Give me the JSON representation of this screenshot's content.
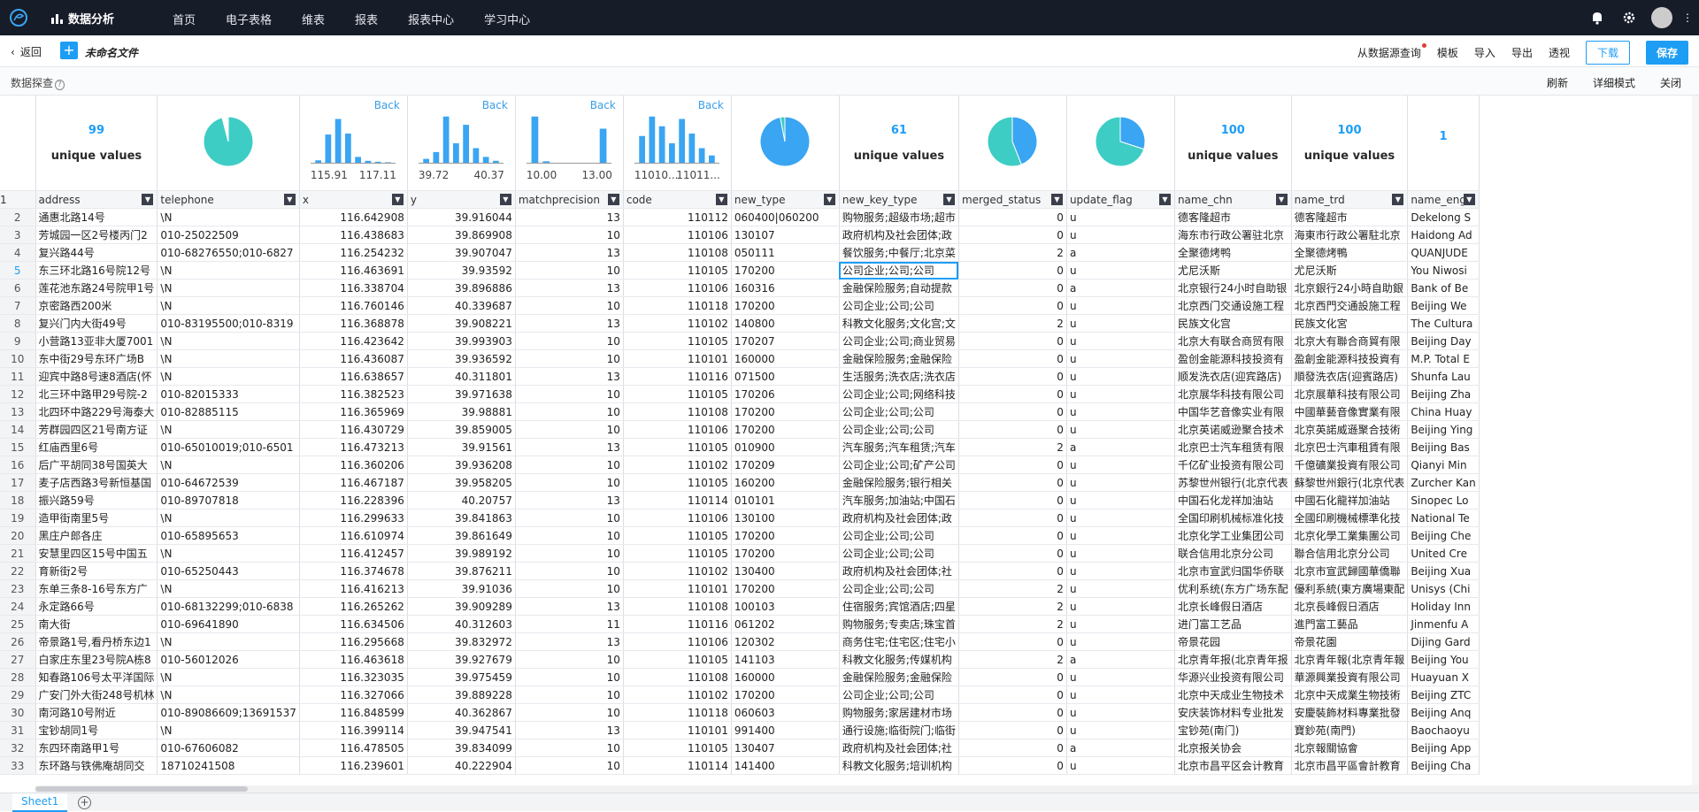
{
  "topnav": {
    "brand": "数据分析",
    "menu": [
      "首页",
      "电子表格",
      "维表",
      "报表",
      "报表中心",
      "学习中心"
    ]
  },
  "filebar": {
    "back": "返回",
    "filename": "未命名文件",
    "actions": [
      "从数据源查询",
      "模板",
      "导入",
      "导出",
      "透视"
    ],
    "download": "下载",
    "save": "保存"
  },
  "probebar": {
    "title": "数据探查",
    "actions": [
      "刷新",
      "详细模式",
      "关闭"
    ]
  },
  "summary": {
    "address": {
      "type": "unique",
      "count": "99",
      "label": "unique values"
    },
    "telephone": {
      "type": "pie",
      "fractions": [
        0.96,
        0.04
      ],
      "colors": [
        "#3ecdc4",
        "#ffffff"
      ]
    },
    "x": {
      "type": "hist",
      "back": "Back",
      "min": "115.91",
      "max": "117.11",
      "bars": [
        0.05,
        0.58,
        0.9,
        0.6,
        0.12,
        0.04,
        0.02,
        0.01
      ]
    },
    "y": {
      "type": "hist",
      "back": "Back",
      "min": "39.72",
      "max": "40.37",
      "bars": [
        0.08,
        0.22,
        0.95,
        0.4,
        0.78,
        0.3,
        0.12,
        0.04
      ]
    },
    "matchprecision": {
      "type": "hist",
      "back": "Back",
      "min": "10.00",
      "max": "13.00",
      "bars": [
        0.95,
        0.03,
        0.0,
        0.0,
        0.0,
        0.0,
        0.7
      ]
    },
    "code": {
      "type": "hist",
      "back": "Back",
      "min": "11010...",
      "max": "11011...",
      "bars": [
        0.55,
        0.95,
        0.75,
        0.4,
        0.9,
        0.6,
        0.3,
        0.15
      ]
    },
    "new_type": {
      "type": "pie",
      "fractions": [
        0.97,
        0.03
      ],
      "colors": [
        "#3aa5f2",
        "#3ecdc4"
      ]
    },
    "new_key_type": {
      "type": "unique",
      "count": "61",
      "label": "unique values"
    },
    "merged_status": {
      "type": "pie",
      "fractions": [
        0.44,
        0.56
      ],
      "colors": [
        "#3aa5f2",
        "#3ecdc4"
      ]
    },
    "update_flag": {
      "type": "pie",
      "fractions": [
        0.3,
        0.7
      ],
      "colors": [
        "#3aa5f2",
        "#3ecdc4"
      ]
    },
    "name_chn": {
      "type": "unique",
      "count": "100",
      "label": "unique values"
    },
    "name_trd": {
      "type": "unique",
      "count": "100",
      "label": "unique values"
    },
    "name_eng": {
      "type": "unique",
      "count": "1",
      "label": ""
    }
  },
  "columns": [
    "address",
    "telephone",
    "x",
    "y",
    "matchprecision",
    "code",
    "new_type",
    "new_key_type",
    "merged_status",
    "update_flag",
    "name_chn",
    "name_trd",
    "name_eng"
  ],
  "rows": [
    [
      "通惠北路14号",
      "\\N",
      "116.642908",
      "39.916044",
      "13",
      "110112",
      "060400|060200",
      "购物服务;超级市场;超市",
      "0",
      "u",
      "德客隆超市",
      "德客隆超市",
      "Dekelong S"
    ],
    [
      "芳城园一区2号楼丙门2",
      "010-25022509",
      "116.438683",
      "39.869908",
      "10",
      "110106",
      "130107",
      "政府机构及社会团体;政",
      "0",
      "u",
      "海东市行政公署驻北京",
      "海東市行政公署駐北京",
      "Haidong Ad"
    ],
    [
      "复兴路44号",
      "010-68276550;010-6827",
      "116.254232",
      "39.907047",
      "13",
      "110108",
      "050111",
      "餐饮服务;中餐厅;北京菜",
      "2",
      "a",
      "全聚德烤鸭",
      "全聚德烤鴨",
      "QUANJUDE"
    ],
    [
      "东三环北路16号院12号",
      "\\N",
      "116.463691",
      "39.93592",
      "10",
      "110105",
      "170200",
      "公司企业;公司;公司",
      "0",
      "u",
      "尤尼沃斯",
      "尤尼沃斯",
      "You Niwosi"
    ],
    [
      "莲花池东路24号院甲1号",
      "\\N",
      "116.338704",
      "39.896886",
      "13",
      "110106",
      "160316",
      "金融保险服务;自动提款",
      "0",
      "a",
      "北京银行24小时自助银",
      "北京銀行24小時自助銀",
      "Bank of Be"
    ],
    [
      "京密路西200米",
      "\\N",
      "116.760146",
      "40.339687",
      "10",
      "110118",
      "170200",
      "公司企业;公司;公司",
      "0",
      "u",
      "北京西门交通设施工程",
      "北京西門交通設施工程",
      "Beijing We"
    ],
    [
      "复兴门内大街49号",
      "010-83195500;010-8319",
      "116.368878",
      "39.908221",
      "13",
      "110102",
      "140800",
      "科教文化服务;文化宫;文",
      "2",
      "u",
      "民族文化宫",
      "民族文化宮",
      "The Cultura"
    ],
    [
      "小营路13亚非大厦7001",
      "\\N",
      "116.423642",
      "39.993903",
      "10",
      "110105",
      "170207",
      "公司企业;公司;商业贸易",
      "0",
      "u",
      "北京大有联合商贸有限",
      "北京大有聯合商貿有限",
      "Beijing Day"
    ],
    [
      "东中街29号东环广场B",
      "\\N",
      "116.436087",
      "39.936592",
      "10",
      "110101",
      "160000",
      "金融保险服务;金融保险",
      "0",
      "u",
      "盈创金能源科技投资有",
      "盈創金能源科技投資有",
      "M.P. Total E"
    ],
    [
      "迎宾中路8号速8酒店(怀",
      "\\N",
      "116.638657",
      "40.311801",
      "13",
      "110116",
      "071500",
      "生活服务;洗衣店;洗衣店",
      "0",
      "u",
      "顺发洗衣店(迎宾路店)",
      "順發洗衣店(迎賓路店)",
      "Shunfa Lau"
    ],
    [
      "北三环中路甲29号院-2",
      "010-82015333",
      "116.382523",
      "39.971638",
      "10",
      "110105",
      "170206",
      "公司企业;公司;网络科技",
      "0",
      "u",
      "北京展华科技有限公司",
      "北京展華科技有限公司",
      "Beijing Zha"
    ],
    [
      "北四环中路229号海泰大",
      "010-82885115",
      "116.365969",
      "39.98881",
      "10",
      "110108",
      "170200",
      "公司企业;公司;公司",
      "0",
      "u",
      "中国华艺音像实业有限",
      "中國華藝音像實業有限",
      "China Huay"
    ],
    [
      "芳群园四区21号南方证",
      "\\N",
      "116.430729",
      "39.859005",
      "10",
      "110106",
      "170200",
      "公司企业;公司;公司",
      "0",
      "u",
      "北京英诺威逊聚合技术",
      "北京英諾威遜聚合技術",
      "Beijing Ying"
    ],
    [
      "红庙西里6号",
      "010-65010019;010-6501",
      "116.473213",
      "39.91561",
      "13",
      "110105",
      "010900",
      "汽车服务;汽车租赁;汽车",
      "2",
      "a",
      "北京巴士汽车租赁有限",
      "北京巴士汽車租賃有限",
      "Beijing Bas"
    ],
    [
      "后广平胡同38号国英大",
      "\\N",
      "116.360206",
      "39.936208",
      "10",
      "110102",
      "170209",
      "公司企业;公司;矿产公司",
      "0",
      "u",
      "千亿矿业投资有限公司",
      "千億礦業投資有限公司",
      "Qianyi Min"
    ],
    [
      "麦子店西路3号新恒基国",
      "010-64672539",
      "116.467187",
      "39.958205",
      "10",
      "110105",
      "160200",
      "金融保险服务;银行相关",
      "0",
      "u",
      "苏黎世州银行(北京代表",
      "蘇黎世州銀行(北京代表",
      "Zurcher Kan"
    ],
    [
      "振兴路59号",
      "010-89707818",
      "116.228396",
      "40.20757",
      "13",
      "110114",
      "010101",
      "汽车服务;加油站;中国石",
      "0",
      "u",
      "中国石化龙祥加油站",
      "中國石化龍祥加油站",
      "Sinopec Lo"
    ],
    [
      "造甲街南里5号",
      "\\N",
      "116.299633",
      "39.841863",
      "10",
      "110106",
      "130100",
      "政府机构及社会团体;政",
      "0",
      "u",
      "全国印刷机械标准化技",
      "全國印刷機械標準化技",
      "National Te"
    ],
    [
      "黑庄户郎各庄",
      "010-65895653",
      "116.610974",
      "39.861649",
      "10",
      "110105",
      "170200",
      "公司企业;公司;公司",
      "0",
      "u",
      "北京化学工业集团公司",
      "北京化學工業集團公司",
      "Beijing Che"
    ],
    [
      "安慧里四区15号中国五",
      "\\N",
      "116.412457",
      "39.989192",
      "10",
      "110105",
      "170200",
      "公司企业;公司;公司",
      "0",
      "u",
      "联合信用北京分公司",
      "聯合信用北京分公司",
      "United Cre"
    ],
    [
      "育新街2号",
      "010-65250443",
      "116.374678",
      "39.876211",
      "10",
      "110102",
      "130400",
      "政府机构及社会团体;社",
      "0",
      "u",
      "北京市宣武归国华侨联",
      "北京市宣武歸國華僑聯",
      "Beijing Xua"
    ],
    [
      "东单三条8-16号东方广",
      "\\N",
      "116.416213",
      "39.91036",
      "10",
      "110101",
      "170200",
      "公司企业;公司;公司",
      "2",
      "u",
      "优利系统(东方广场东配",
      "優利系統(東方廣場東配",
      "Unisys (Chi"
    ],
    [
      "永定路66号",
      "010-68132299;010-6838",
      "116.265262",
      "39.909289",
      "13",
      "110108",
      "100103",
      "住宿服务;宾馆酒店;四星",
      "2",
      "u",
      "北京长峰假日酒店",
      "北京長峰假日酒店",
      "Holiday Inn"
    ],
    [
      "南大街",
      "010-69641890",
      "116.634506",
      "40.312603",
      "11",
      "110116",
      "061202",
      "购物服务;专卖店;珠宝首",
      "2",
      "u",
      "进门富工艺品",
      "進門富工藝品",
      "Jinmenfu A"
    ],
    [
      "帝景路1号,看丹桥东边1",
      "\\N",
      "116.295668",
      "39.832972",
      "13",
      "110106",
      "120302",
      "商务住宅;住宅区;住宅小",
      "0",
      "u",
      "帝景花园",
      "帝景花園",
      "Dijing Gard"
    ],
    [
      "白家庄东里23号院A栋8",
      "010-56012026",
      "116.463618",
      "39.927679",
      "10",
      "110105",
      "141103",
      "科教文化服务;传媒机构",
      "2",
      "a",
      "北京青年报(北京青年报",
      "北京青年報(北京青年報",
      "Beijing You"
    ],
    [
      "知春路106号太平洋国际",
      "\\N",
      "116.323035",
      "39.975459",
      "10",
      "110108",
      "160000",
      "金融保险服务;金融保险",
      "0",
      "u",
      "华源兴业投资有限公司",
      "華源興業投資有限公司",
      "Huayuan X"
    ],
    [
      "广安门外大街248号机林",
      "\\N",
      "116.327066",
      "39.889228",
      "10",
      "110102",
      "170200",
      "公司企业;公司;公司",
      "0",
      "u",
      "北京中天成业生物技术",
      "北京中天成業生物技術",
      "Beijing ZTC"
    ],
    [
      "南河路10号附近",
      "010-89086609;13691537",
      "116.848599",
      "40.362867",
      "10",
      "110118",
      "060603",
      "购物服务;家居建材市场",
      "0",
      "u",
      "安庆装饰材料专业批发",
      "安慶裝飾材料專業批發",
      "Beijing Anq"
    ],
    [
      "宝钞胡同1号",
      "\\N",
      "116.399114",
      "39.947541",
      "13",
      "110101",
      "991400",
      "通行设施;临街院门;临街",
      "0",
      "u",
      "宝钞苑(南门)",
      "寶鈔苑(南門)",
      "Baochaoyu"
    ],
    [
      "东四环南路甲1号",
      "010-67606082",
      "116.478505",
      "39.834099",
      "10",
      "110105",
      "130407",
      "政府机构及社会团体;社",
      "0",
      "a",
      "北京报关协会",
      "北京報關協會",
      "Beijing App"
    ],
    [
      "东环路与铁佛庵胡同交",
      "18710241508",
      "116.239601",
      "40.222904",
      "10",
      "110114",
      "141400",
      "科教文化服务;培训机构",
      "0",
      "u",
      "北京市昌平区会计教育",
      "北京市昌平區會計教育",
      "Beijing Cha"
    ]
  ]
}
